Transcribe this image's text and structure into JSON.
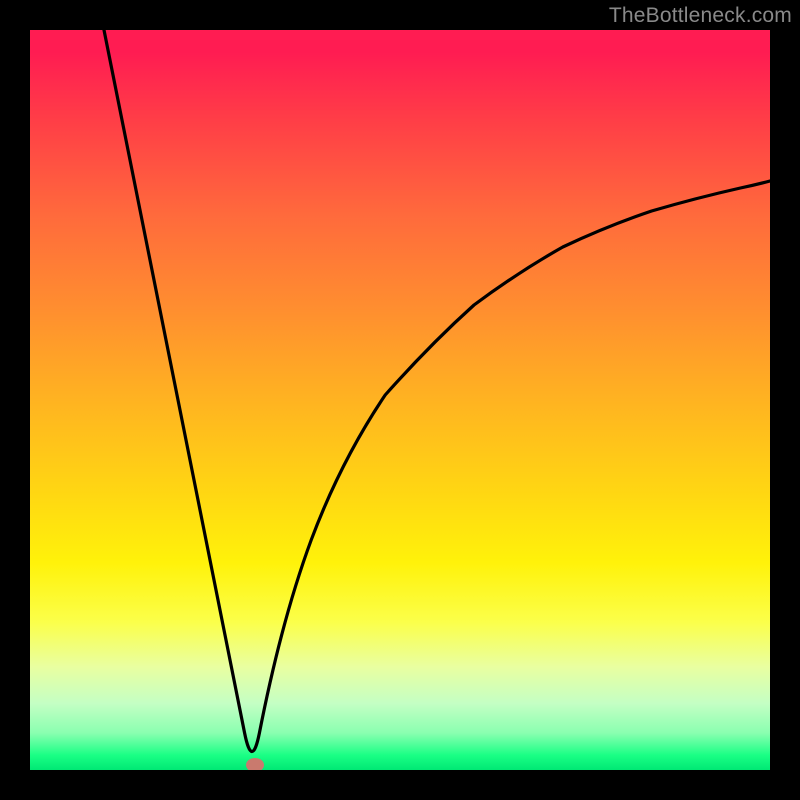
{
  "watermark": {
    "text": "TheBottleneck.com"
  },
  "chart_data": {
    "type": "line",
    "title": "",
    "xlabel": "",
    "ylabel": "",
    "xlim": [
      0,
      100
    ],
    "ylim": [
      0,
      100
    ],
    "grid": false,
    "legend": false,
    "background": "rainbow-gradient-red-to-green",
    "marker": {
      "x": 30,
      "y": 0,
      "color": "#c97a6e"
    },
    "series": [
      {
        "name": "bottleneck-curve",
        "x": [
          10,
          12,
          14,
          16,
          18,
          20,
          22,
          24,
          26,
          28,
          29,
          30,
          31,
          32,
          34,
          36,
          38,
          40,
          44,
          48,
          52,
          56,
          60,
          64,
          68,
          72,
          76,
          80,
          84,
          88,
          92,
          96,
          100
        ],
        "y": [
          100,
          90,
          80,
          70,
          60,
          50,
          40,
          30,
          20,
          10,
          5,
          0,
          5,
          10,
          20,
          28,
          35,
          41,
          50,
          57,
          62,
          66,
          69,
          72,
          74,
          76,
          77.5,
          79,
          80,
          81,
          82,
          82.5,
          83
        ]
      }
    ],
    "note": "Values estimated from pixel positions of the plotted curve and marker; axes are unlabeled and normalized 0–100."
  }
}
